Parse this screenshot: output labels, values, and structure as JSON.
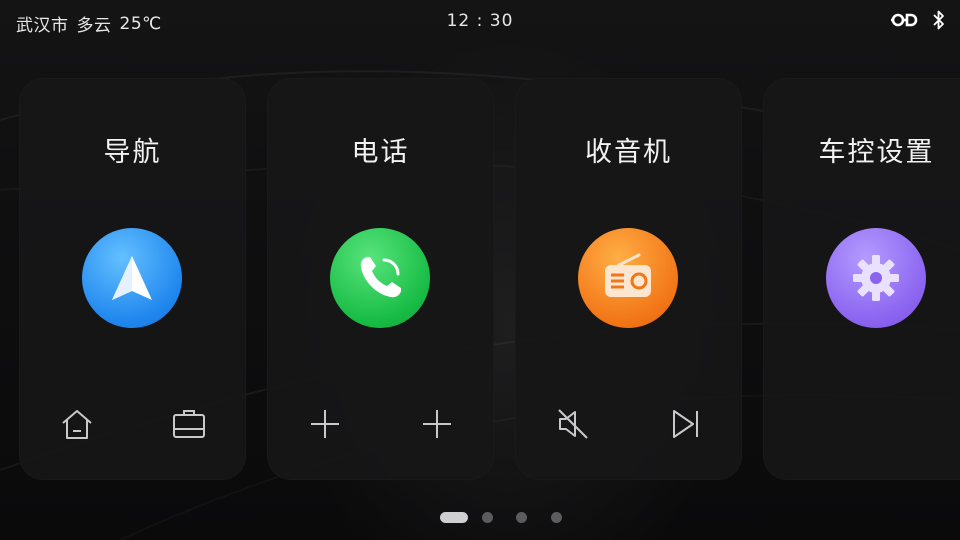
{
  "status_bar": {
    "city": "武汉市",
    "weather": "多云",
    "temperature": "25℃",
    "time": "12 : 30",
    "icons": [
      "link-icon",
      "bluetooth-icon"
    ]
  },
  "cards": [
    {
      "title": "导航",
      "app_icon": "navigation-arrow-icon",
      "color": "#1f86ee",
      "shortcuts": [
        "home-icon",
        "briefcase-icon"
      ]
    },
    {
      "title": "电话",
      "app_icon": "phone-handset-icon",
      "color": "#17bb44",
      "shortcuts": [
        "plus-icon",
        "plus-icon"
      ]
    },
    {
      "title": "收音机",
      "app_icon": "radio-icon",
      "color": "#f27516",
      "shortcuts": [
        "mute-icon",
        "skip-next-icon"
      ]
    },
    {
      "title": "车控设置",
      "app_icon": "gear-icon",
      "color": "#8a63f0",
      "shortcuts": []
    }
  ],
  "pager": {
    "pages": 4,
    "active_index": 0
  }
}
